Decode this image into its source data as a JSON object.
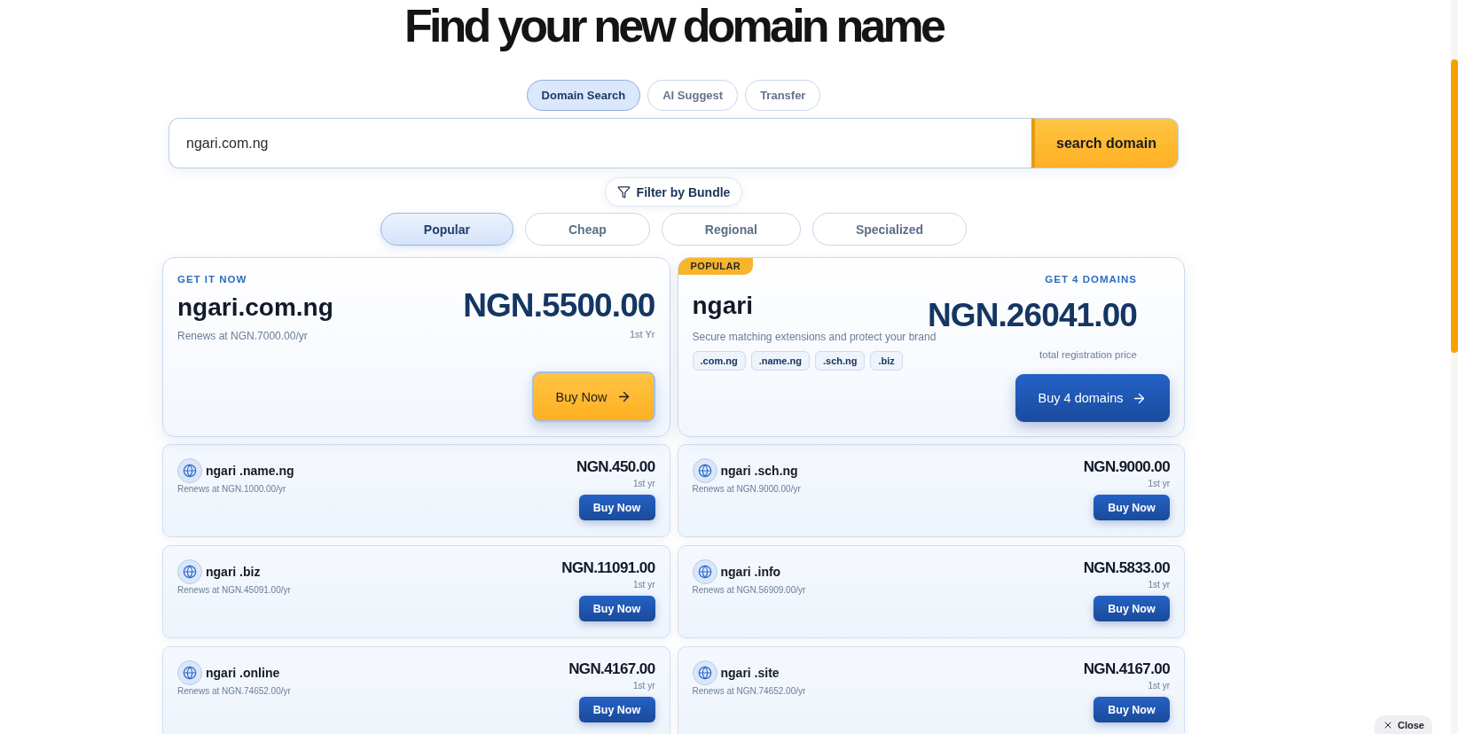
{
  "title": "Find your new domain name",
  "search_modes": [
    {
      "label": "Domain Search",
      "selected": true
    },
    {
      "label": "AI Suggest",
      "selected": false
    },
    {
      "label": "Transfer",
      "selected": false
    }
  ],
  "search": {
    "value": "ngari.com.ng",
    "button": "search domain"
  },
  "filter_button": "Filter by Bundle",
  "categories": [
    {
      "label": "Popular",
      "selected": true
    },
    {
      "label": "Cheap",
      "selected": false
    },
    {
      "label": "Regional",
      "selected": false
    },
    {
      "label": "Specialized",
      "selected": false
    }
  ],
  "featured": {
    "label": "GET IT NOW",
    "domain": "ngari.com.ng",
    "renewal": "Renews at NGN.7000.00/yr",
    "price": "NGN.5500.00",
    "period": "1st Yr",
    "button": "Buy Now"
  },
  "bundle": {
    "badge": "POPULAR",
    "label": "GET 4 DOMAINS",
    "name": "ngari",
    "description": "Secure matching extensions and protect your brand",
    "extensions": [
      ".com.ng",
      ".name.ng",
      ".sch.ng",
      ".biz"
    ],
    "price": "NGN.26041.00",
    "price_note": "total registration price",
    "button": "Buy 4 domains"
  },
  "results": [
    {
      "domain": "ngari .name.ng",
      "renewal": "Renews at NGN.1000.00/yr",
      "price": "NGN.450.00",
      "period": "1st yr",
      "button": "Buy Now"
    },
    {
      "domain": "ngari .sch.ng",
      "renewal": "Renews at NGN.9000.00/yr",
      "price": "NGN.9000.00",
      "period": "1st yr",
      "button": "Buy Now"
    },
    {
      "domain": "ngari .biz",
      "renewal": "Renews at NGN.45091.00/yr",
      "price": "NGN.11091.00",
      "period": "1st yr",
      "button": "Buy Now"
    },
    {
      "domain": "ngari .info",
      "renewal": "Renews at NGN.56909.00/yr",
      "price": "NGN.5833.00",
      "period": "1st yr",
      "button": "Buy Now"
    },
    {
      "domain": "ngari .online",
      "renewal": "Renews at NGN.74652.00/yr",
      "price": "NGN.4167.00",
      "period": "1st yr",
      "button": "Buy Now"
    },
    {
      "domain": "ngari .site",
      "renewal": "Renews at NGN.74652.00/yr",
      "price": "NGN.4167.00",
      "period": "1st yr",
      "button": "Buy Now"
    }
  ],
  "close_button": "Close"
}
